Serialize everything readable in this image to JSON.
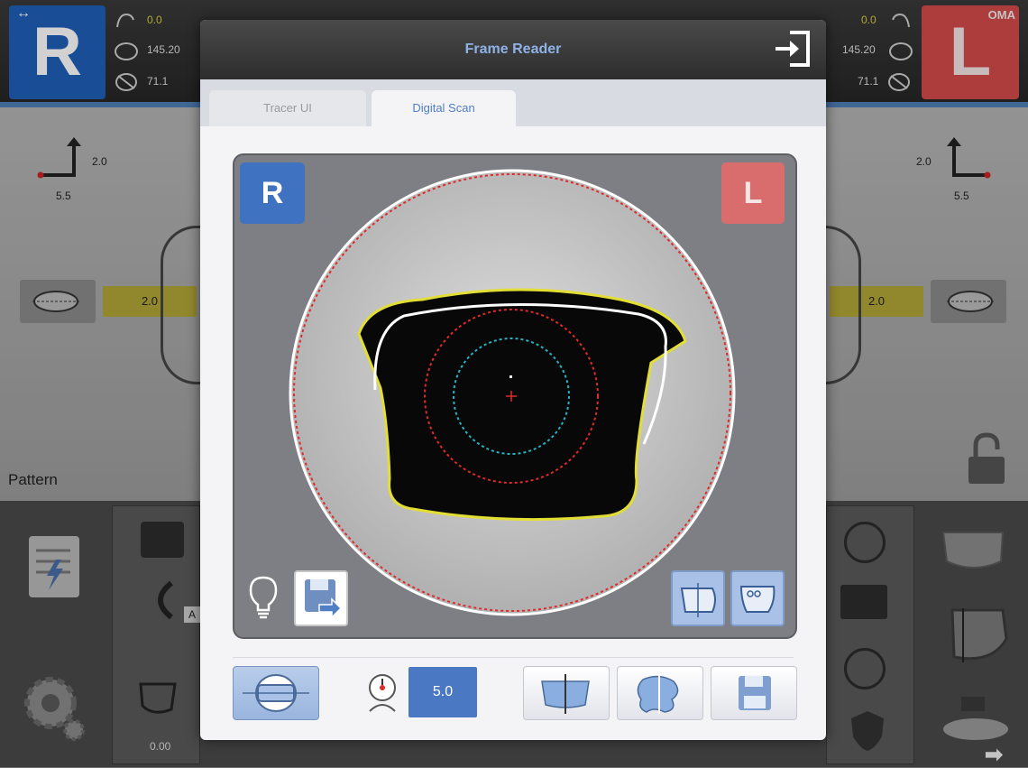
{
  "background": {
    "right_eye": {
      "label": "R",
      "axis_value": "0.0",
      "circ_value": "145.20",
      "diam_value": "71.1"
    },
    "left_eye": {
      "label": "L",
      "tag": "OMA",
      "axis_value": "0.0",
      "circ_value": "145.20",
      "diam_value": "71.1"
    },
    "right_offset": {
      "y": "2.0",
      "x": "5.5"
    },
    "left_offset": {
      "y": "2.0",
      "x": "5.5"
    },
    "right_bevel_value": "2.0",
    "left_bevel_value": "2.0",
    "pattern_label": "Pattern",
    "bottom_value": "0.00",
    "panel_a_label": "A"
  },
  "modal": {
    "title": "Frame Reader",
    "tabs": [
      {
        "label": "Tracer UI",
        "active": false
      },
      {
        "label": "Digital Scan",
        "active": true
      }
    ],
    "viewer": {
      "right_badge": "R",
      "left_badge": "L"
    },
    "toolbar": {
      "value": "5.0"
    }
  },
  "colors": {
    "accent_blue": "#4b78c2",
    "right_eye": "#1f5eb8",
    "left_eye": "#d34b4b",
    "highlight_yellow": "#d7cc3a",
    "scan_trace": "#e3de36",
    "scan_red": "#e02a2a",
    "scan_cyan": "#27b3c2"
  },
  "icons": [
    "arrows-horizontal-icon",
    "nose-pad-icon",
    "circumference-icon",
    "diameter-icon",
    "exit-icon",
    "lightbulb-icon",
    "save-export-icon",
    "shape-rotate-icon",
    "shape-hole-icon",
    "frame-mode-icon",
    "dial-icon",
    "split-shape-icon",
    "edit-shape-icon",
    "save-icon",
    "lock-icon",
    "settings-gear-icon",
    "job-list-icon"
  ]
}
